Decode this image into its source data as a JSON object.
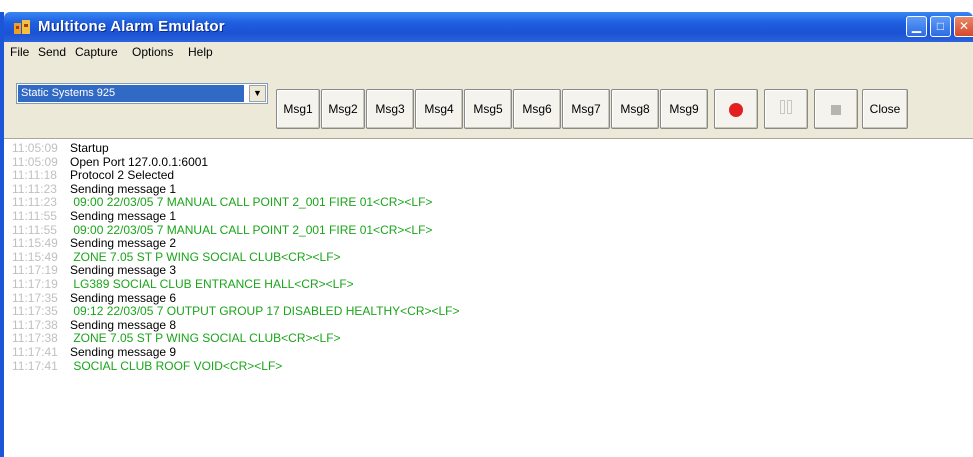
{
  "window": {
    "title": "Multitone Alarm Emulator",
    "colors": {
      "title_bar": "#1f5fe0",
      "selection": "#316ac5",
      "record": "#e31f1f",
      "log_green": "#1aa51a",
      "timestamp": "#c0c0c0"
    }
  },
  "menu": [
    "File",
    "Send",
    "Capture",
    "Options",
    "Help"
  ],
  "toolbar": {
    "system_select": "Static Systems 925",
    "buttons": [
      "Msg1",
      "Msg2",
      "Msg3",
      "Msg4",
      "Msg5",
      "Msg6",
      "Msg7",
      "Msg8",
      "Msg9"
    ],
    "icons": [
      "record-icon",
      "pause-icon",
      "stop-icon"
    ],
    "close_label": "Close"
  },
  "log": [
    {
      "time": "11:05:09",
      "text": "Startup",
      "type": "status"
    },
    {
      "time": "11:05:09",
      "text": "Open Port 127.0.0.1:6001",
      "type": "status"
    },
    {
      "time": "11:11:18",
      "text": "Protocol 2 Selected",
      "type": "status"
    },
    {
      "time": "11:11:23",
      "text": "Sending message 1",
      "type": "status"
    },
    {
      "time": "11:11:23",
      "text": " 09:00 22/03/05 7 MANUAL CALL POINT 2_001 FIRE 01<CR><LF>",
      "type": "data"
    },
    {
      "time": "11:11:55",
      "text": "Sending message 1",
      "type": "status"
    },
    {
      "time": "11:11:55",
      "text": " 09:00 22/03/05 7 MANUAL CALL POINT 2_001 FIRE 01<CR><LF>",
      "type": "data"
    },
    {
      "time": "11:15:49",
      "text": "Sending message 2",
      "type": "status"
    },
    {
      "time": "11:15:49",
      "text": " ZONE 7.05 ST P WING SOCIAL CLUB<CR><LF>",
      "type": "data"
    },
    {
      "time": "11:17:19",
      "text": "Sending message 3",
      "type": "status"
    },
    {
      "time": "11:17:19",
      "text": " LG389 SOCIAL CLUB ENTRANCE HALL<CR><LF>",
      "type": "data"
    },
    {
      "time": "11:17:35",
      "text": "Sending message 6",
      "type": "status"
    },
    {
      "time": "11:17:35",
      "text": " 09:12 22/03/05 7 OUTPUT GROUP 17 DISABLED HEALTHY<CR><LF>",
      "type": "data"
    },
    {
      "time": "11:17:38",
      "text": "Sending message 8",
      "type": "status"
    },
    {
      "time": "11:17:38",
      "text": " ZONE 7.05 ST P WING SOCIAL CLUB<CR><LF>",
      "type": "data"
    },
    {
      "time": "11:17:41",
      "text": "Sending message 9",
      "type": "status"
    },
    {
      "time": "11:17:41",
      "text": " SOCIAL CLUB ROOF VOID<CR><LF>",
      "type": "data"
    }
  ]
}
